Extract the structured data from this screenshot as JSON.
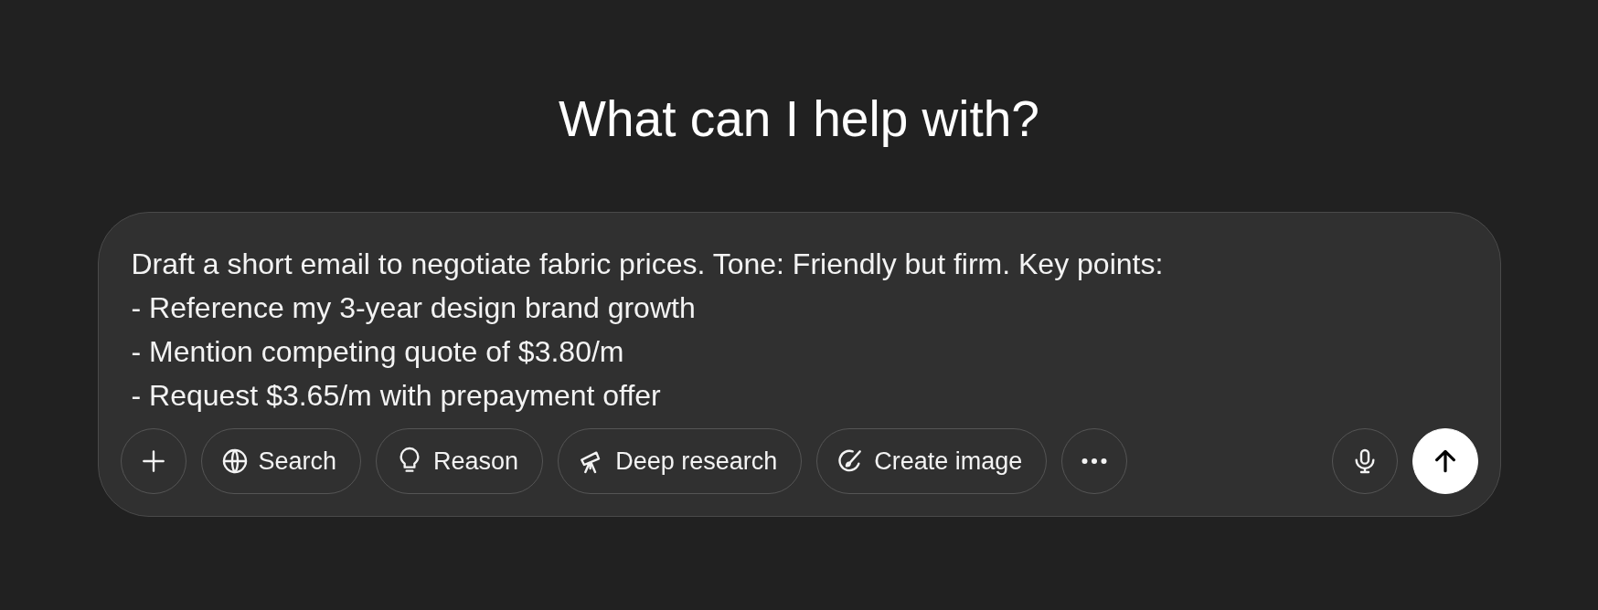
{
  "heading": "What can I help with?",
  "composer": {
    "value": "Draft a short email to negotiate fabric prices. Tone: Friendly but firm. Key points:\n- Reference my 3-year design brand growth\n- Mention competing quote of $3.80/m\n- Request $3.65/m with prepayment offer",
    "tools": [
      {
        "label": "Search"
      },
      {
        "label": "Reason"
      },
      {
        "label": "Deep research"
      },
      {
        "label": "Create image"
      }
    ]
  }
}
